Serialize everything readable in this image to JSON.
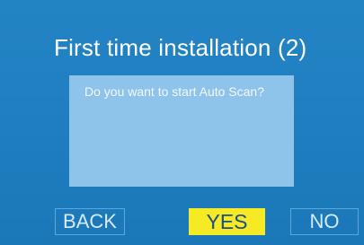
{
  "screen": {
    "title": "First time installation (2)",
    "background_color": "#1f7fc0"
  },
  "dialog": {
    "message": "Do you want to start Auto Scan?",
    "panel_color": "#8ec3ea"
  },
  "buttons": {
    "back_label": "BACK",
    "yes_label": "YES",
    "no_label": "NO",
    "selected": "YES",
    "selected_color": "#f5ea23"
  }
}
